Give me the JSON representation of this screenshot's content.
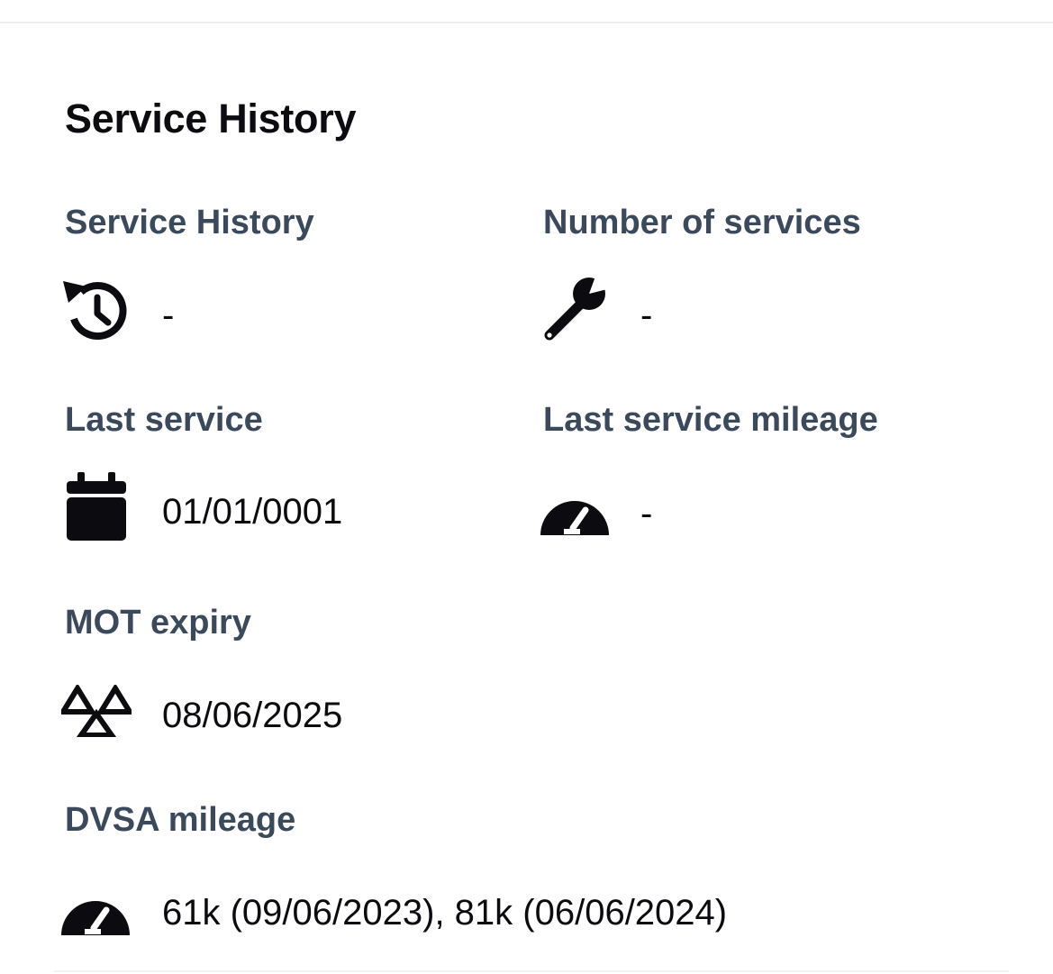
{
  "section": {
    "title": "Service History"
  },
  "fields": {
    "service_history": {
      "label": "Service History",
      "value": "-",
      "icon": "history-icon"
    },
    "number_of_services": {
      "label": "Number of services",
      "value": "-",
      "icon": "wrench-icon"
    },
    "last_service": {
      "label": "Last service",
      "value": "01/01/0001",
      "icon": "calendar-icon"
    },
    "last_service_mileage": {
      "label": "Last service mileage",
      "value": "-",
      "icon": "speedometer-icon"
    },
    "mot_expiry": {
      "label": "MOT expiry",
      "value": "08/06/2025",
      "icon": "mot-triangles-icon"
    },
    "dvsa_mileage": {
      "label": "DVSA mileage",
      "value": "61k (09/06/2023), 81k (06/06/2024)",
      "icon": "speedometer-icon"
    }
  },
  "colors": {
    "title": "#0b0b10",
    "label": "#3a4a5c",
    "value": "#0b0b10",
    "icon": "#0b0b10",
    "divider": "#eceef1",
    "background": "#ffffff"
  }
}
